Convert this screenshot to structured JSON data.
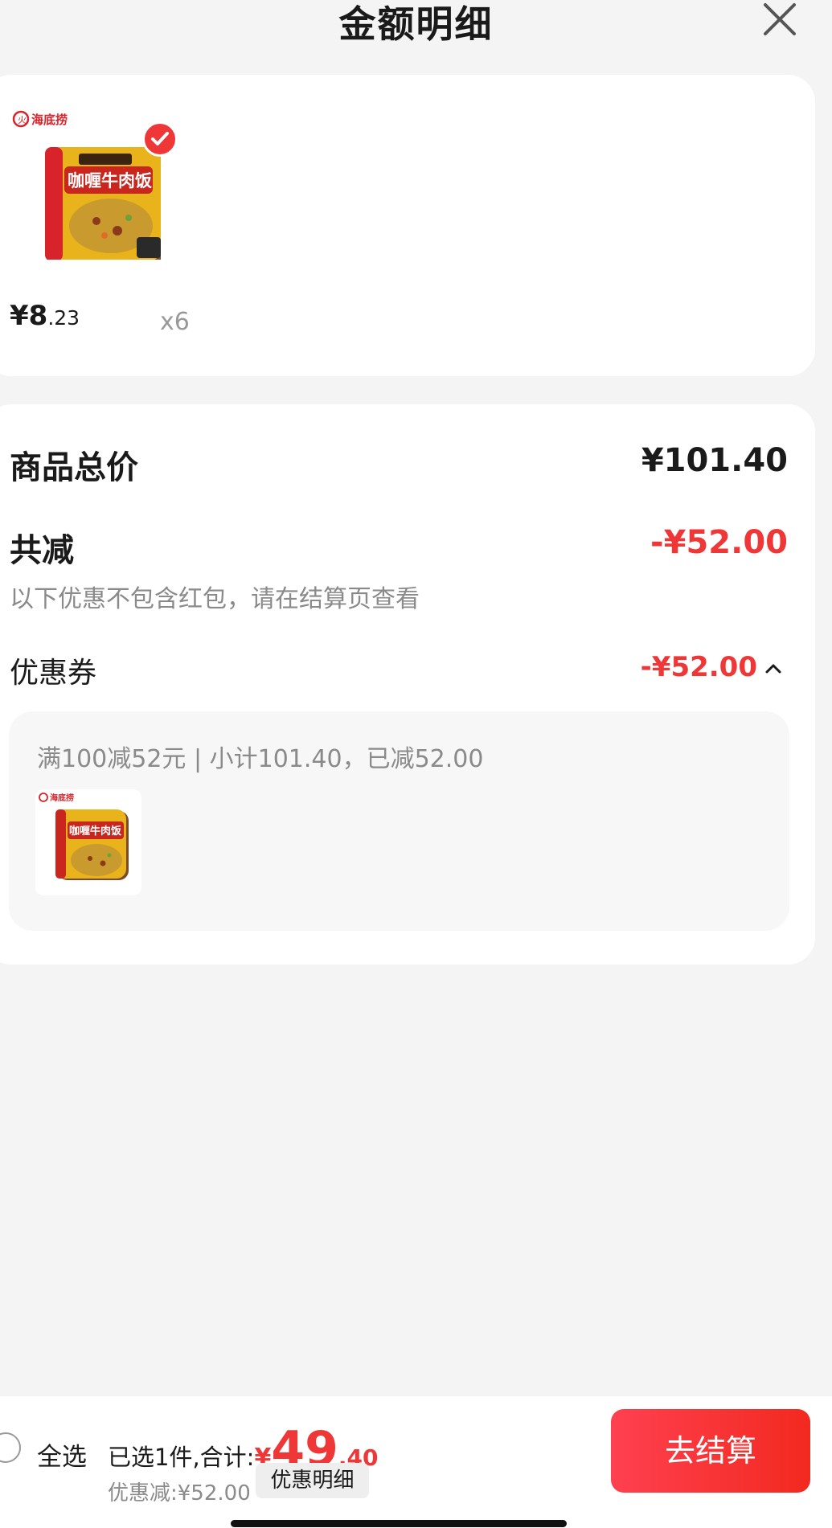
{
  "header": {
    "title": "金额明细"
  },
  "item": {
    "brand": "海底捞",
    "product_name": "咖喱牛肉饭",
    "price_prefix": "¥8",
    "price_cents": ".23",
    "quantity": "x6"
  },
  "summary": {
    "goods_total_label": "商品总价",
    "goods_total_value": "¥101.40",
    "reduction_label": "共减",
    "reduction_value": "-¥52.00",
    "note": "以下优惠不包含红包，请在结算页查看",
    "coupon_label": "优惠券",
    "coupon_value": "-¥52.00",
    "coupon_detail": "满100减52元 | 小计101.40，已减52.00"
  },
  "bottom": {
    "select_all_label": "全选",
    "selected_text": "已选1件,合计:",
    "currency": "¥",
    "total_int": "49",
    "total_dec": ".40",
    "discount_text": "优惠减:¥52.00",
    "discount_detail_button": "优惠明细",
    "checkout_button": "去结算"
  },
  "colors": {
    "accent": "#f03737",
    "text": "#1a1a1a",
    "muted": "#8a8a8a"
  },
  "icons": [
    "close-icon",
    "checkmark-icon",
    "chevron-up-icon",
    "radio-unchecked-icon"
  ]
}
